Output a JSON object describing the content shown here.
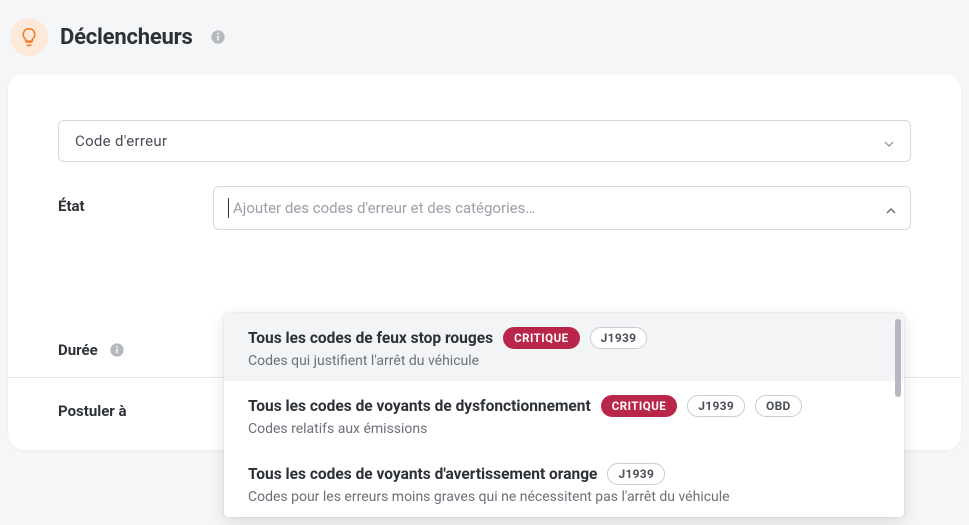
{
  "header": {
    "title": "Déclencheurs"
  },
  "trigger_select": {
    "value": "Code d'erreur"
  },
  "etat": {
    "label": "État",
    "placeholder": "Ajouter des codes d'erreur et des catégories…"
  },
  "dropdown": {
    "items": [
      {
        "title": "Tous les codes de feux stop rouges",
        "badges_critical": "CRITIQUE",
        "badges_outline_1": "J1939",
        "badges_outline_2": "",
        "desc": "Codes qui justifient l'arrêt du véhicule",
        "active": true
      },
      {
        "title": "Tous les codes de voyants de dysfonctionnement",
        "badges_critical": "CRITIQUE",
        "badges_outline_1": "J1939",
        "badges_outline_2": "OBD",
        "desc": "Codes relatifs aux émissions",
        "active": false
      },
      {
        "title": "Tous les codes de voyants d'avertissement orange",
        "badges_critical": "",
        "badges_outline_1": "J1939",
        "badges_outline_2": "",
        "desc": "Codes pour les erreurs moins graves qui ne nécessitent pas l'arrêt du véhicule",
        "active": false
      }
    ]
  },
  "duree": {
    "label": "Durée"
  },
  "postuler": {
    "label": "Postuler à"
  }
}
